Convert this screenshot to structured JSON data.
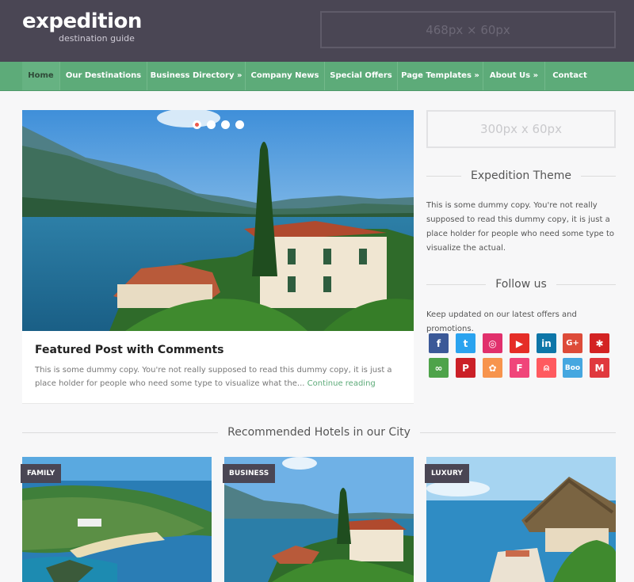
{
  "header": {
    "logo": "expedition",
    "tagline": "destination guide",
    "ad_text": "468px × 60px"
  },
  "nav": {
    "items": [
      {
        "label": "Home"
      },
      {
        "label": "Our Destinations"
      },
      {
        "label": "Business Directory »"
      },
      {
        "label": "Company News"
      },
      {
        "label": "Special Offers"
      },
      {
        "label": "Page Templates »"
      },
      {
        "label": "About Us »"
      },
      {
        "label": "Contact"
      }
    ]
  },
  "slider": {
    "dots": 4,
    "active_dot": 1
  },
  "featured": {
    "title": "Featured Post with Comments",
    "excerpt": "This is some dummy copy. You're not really supposed to read this dummy copy, it is just a place holder for people who need some type to visualize what the...",
    "continue": "Continue reading"
  },
  "sidebar": {
    "ad_text": "300px x 60px",
    "theme_title": "Expedition Theme",
    "theme_text": "This is some dummy copy. You're not really supposed to read this dummy copy, it is just a place holder for people who need some type to visualize the actual.",
    "follow_title": "Follow us",
    "follow_text": "Keep updated on our latest offers and promotions.",
    "social": [
      {
        "name": "facebook-icon",
        "glyph": "f",
        "color": "#3b5998"
      },
      {
        "name": "twitter-icon",
        "glyph": "t",
        "color": "#2aa3ef"
      },
      {
        "name": "instagram-icon",
        "glyph": "◎",
        "color": "#e1306c"
      },
      {
        "name": "youtube-icon",
        "glyph": "▶",
        "color": "#e52d27"
      },
      {
        "name": "linkedin-icon",
        "glyph": "in",
        "color": "#0e76a8"
      },
      {
        "name": "google-plus-icon",
        "glyph": "G+",
        "color": "#dd4b39"
      },
      {
        "name": "yelp-icon",
        "glyph": "✱",
        "color": "#d32323"
      },
      {
        "name": "tripadvisor-icon",
        "glyph": "∞",
        "color": "#4ea34a"
      },
      {
        "name": "pinterest-icon",
        "glyph": "P",
        "color": "#cb2027"
      },
      {
        "name": "foursquare-icon",
        "glyph": "✿",
        "color": "#f7944d"
      },
      {
        "name": "flickr-icon",
        "glyph": "F",
        "color": "#f0457a"
      },
      {
        "name": "airbnb-icon",
        "glyph": "⍝",
        "color": "#ff5a5f"
      },
      {
        "name": "blogger-icon",
        "glyph": "Boo",
        "color": "#45a7e0"
      },
      {
        "name": "meetup-icon",
        "glyph": "M",
        "color": "#e0393e"
      }
    ]
  },
  "section": {
    "title": "Recommended Hotels in our City"
  },
  "hotels": [
    {
      "badge": "FAMILY"
    },
    {
      "badge": "BUSINESS"
    },
    {
      "badge": "LUXURY"
    }
  ]
}
